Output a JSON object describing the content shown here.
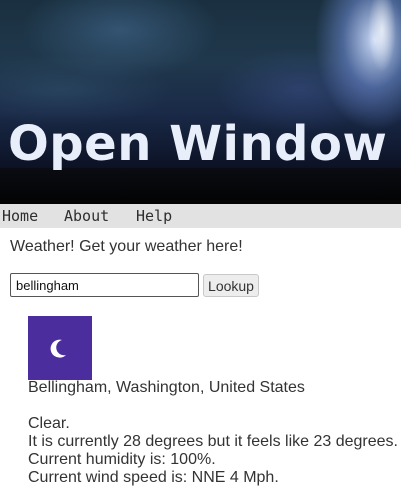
{
  "site": {
    "title": "Open Window"
  },
  "nav": {
    "items": [
      "Home",
      "About",
      "Help"
    ]
  },
  "tagline": "Weather! Get your weather here!",
  "search": {
    "value": "bellingham",
    "button_label": "Lookup"
  },
  "weather": {
    "icon": "moon-icon",
    "location": "Bellingham, Washington, United States",
    "condition": "Clear.",
    "temperature_text": "It is currently 28 degrees but it feels like 23 degrees.",
    "humidity_text": "Current humidity is: 100%.",
    "wind_text": "Current wind speed is: NNE 4 Mph."
  },
  "colors": {
    "icon_background": "#4b2d9d",
    "nav_background": "#e2e2e2"
  }
}
